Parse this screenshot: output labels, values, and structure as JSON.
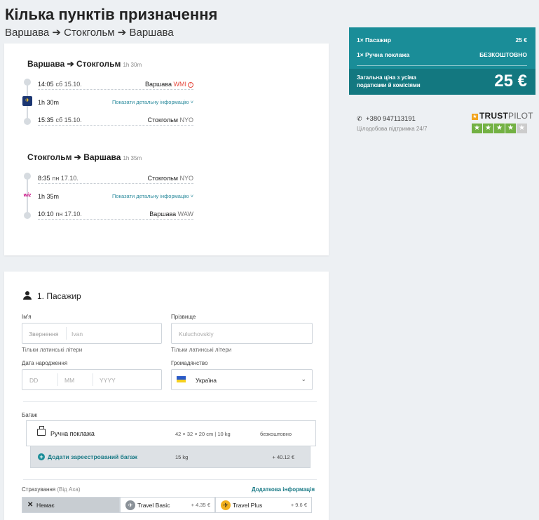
{
  "header": {
    "title": "Кілька пунктів призначення",
    "subtitle": "Варшава ➔ Стокгольм ➔ Варшава"
  },
  "itinerary": {
    "segments": [
      {
        "title": "Варшава ➔ Стокгольм",
        "duration": "1h 30m",
        "departure": {
          "time": "14:05",
          "day": "сб 15.10.",
          "city": "Варшава",
          "code": "WMI"
        },
        "flight": {
          "duration": "1h 30m",
          "detail_link": "Показати детальну інформацію ˅",
          "airline_icon": "ryanair-logo-icon"
        },
        "arrival": {
          "time": "15:35",
          "day": "сб 15.10.",
          "city": "Стокгольм",
          "code": "NYO"
        }
      },
      {
        "title": "Стокгольм ➔ Варшава",
        "duration": "1h 35m",
        "departure": {
          "time": "8:35",
          "day": "пн 17.10.",
          "city": "Стокгольм",
          "code": "NYO"
        },
        "flight": {
          "duration": "1h 35m",
          "detail_link": "Показати детальну інформацію ˅",
          "airline_icon": "wizzair-logo-icon"
        },
        "arrival": {
          "time": "10:10",
          "day": "пн 17.10.",
          "city": "Варшава",
          "code": "WAW"
        }
      }
    ]
  },
  "summary": {
    "rows": [
      {
        "label": "1× Пасажир",
        "value": "25 €"
      },
      {
        "label": "1× Ручна поклажа",
        "value": "БЕЗКОШТОВНО"
      }
    ],
    "total_label": "Загальна ціна з усіма податками й комісіями",
    "total_value": "25 €",
    "bg_color": "#1a8d98"
  },
  "support": {
    "phone": "+380 947113191",
    "note": "Цілодобова підтримка 24/7",
    "trustpilot_brand": "TRUSTPILOT",
    "trustpilot_brand_bold": "TRUST",
    "trustpilot_brand_thin": "PILOT",
    "rating_stars": 4,
    "rating_max": 5
  },
  "passenger": {
    "section_title": "1. Пасажир",
    "first_name_label": "Ім'я",
    "salutation_placeholder": "Звернення",
    "first_name_placeholder": "Ivan",
    "first_name_hint": "Тільки латинські літери",
    "last_name_label": "Прізвище",
    "last_name_placeholder": "Kuluchovskiy",
    "last_name_hint": "Тільки латинські літери",
    "dob_label": "Дата народження",
    "dob_dd": "DD",
    "dob_mm": "MM",
    "dob_yyyy": "YYYY",
    "citizenship_label": "Громадянство",
    "citizenship_value": "Україна"
  },
  "baggage": {
    "label": "Багаж",
    "hand_name": "Ручна поклажа",
    "hand_dims": "42 × 32 × 20 cm | 10 kg",
    "hand_price": "безкоштовно",
    "add_label": "Додати зареєстрований багаж",
    "add_weight": "15 kg",
    "add_price": "+ 40.12 €"
  },
  "insurance": {
    "label": "Страхування",
    "provider": "(Від Axa)",
    "more_info": "Додаткова інформація",
    "options": [
      {
        "name": "Немає",
        "price": ""
      },
      {
        "name": "Travel Basic",
        "price": "+ 4.35 €"
      },
      {
        "name": "Travel Plus",
        "price": "+ 9.6 €"
      }
    ]
  }
}
